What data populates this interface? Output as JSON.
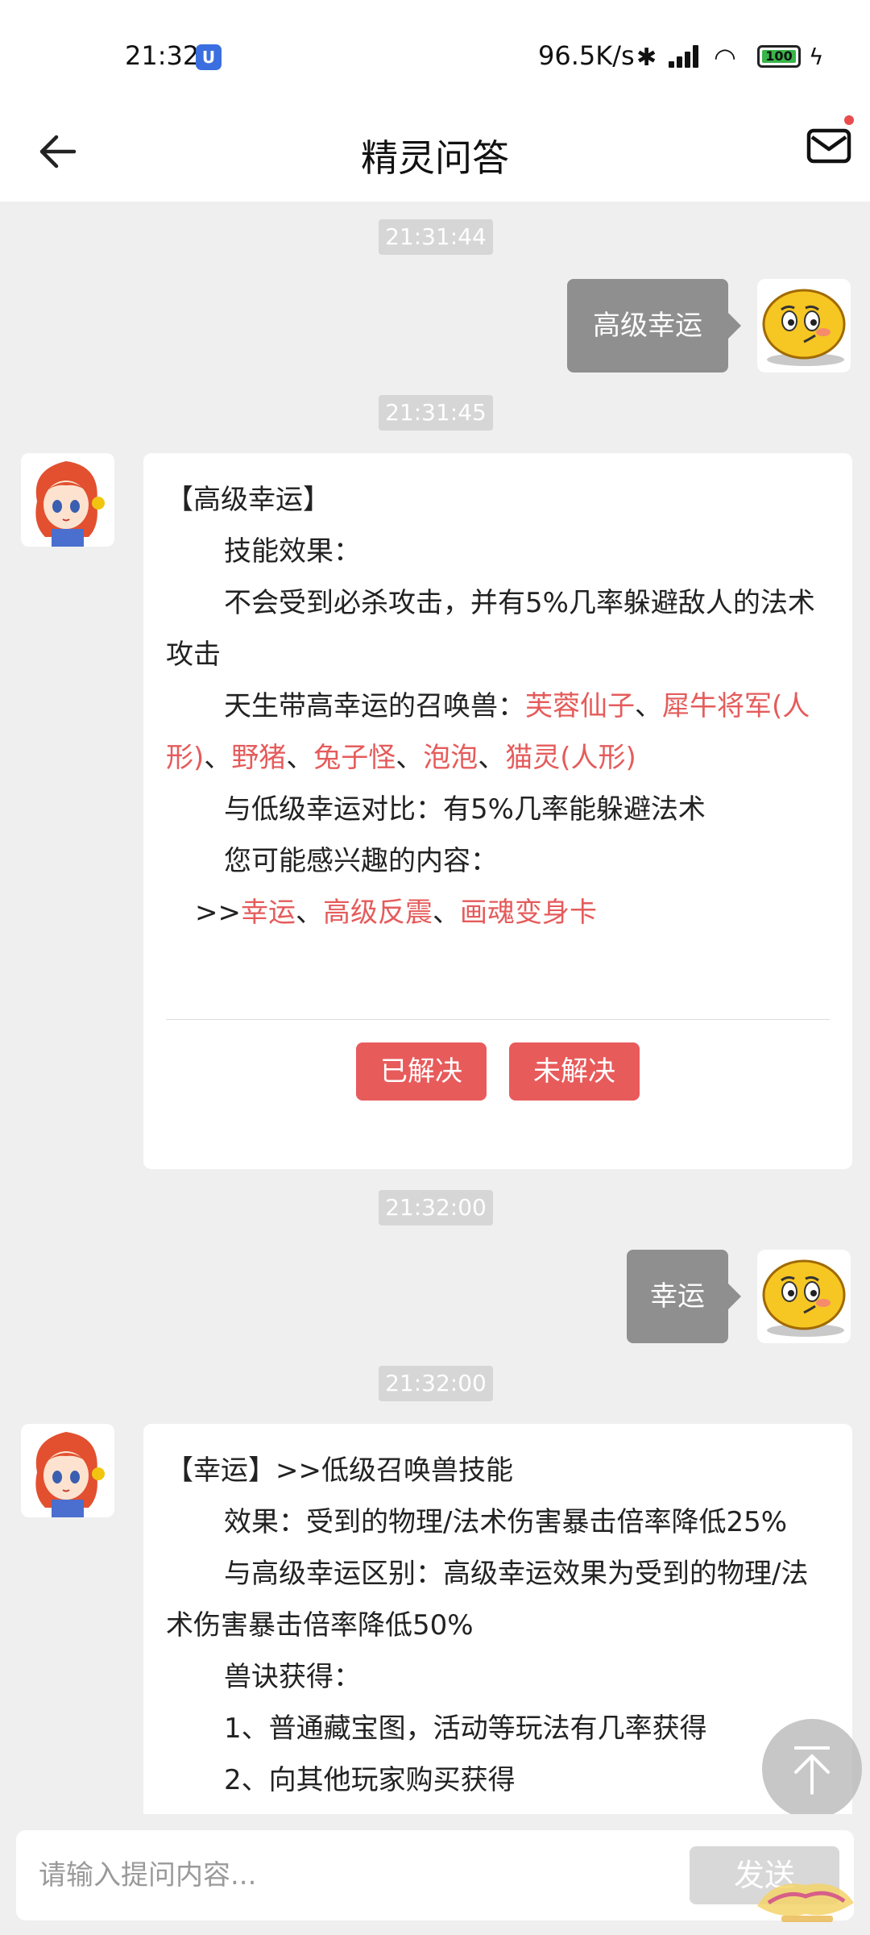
{
  "status_bar": {
    "time": "21:32",
    "net_speed": "96.5K/s",
    "battery": "100"
  },
  "header": {
    "title": "精灵问答"
  },
  "messages": {
    "ts1": "21:31:44",
    "q1": "高级幸运",
    "ts2": "21:31:45",
    "a1": {
      "title": "【高级幸运】",
      "effect_label": "技能效果：",
      "effect_text": "不会受到必杀攻击，并有5%几率躲避敌人的法术攻击",
      "pets_label": "天生带高幸运的召唤兽：",
      "pet1": "芙蓉仙子",
      "pet2": "犀牛将军(人形)",
      "pet3": "野猪",
      "pet4": "兔子怪",
      "pet5": "泡泡",
      "pet6": "猫灵(人形)",
      "sep": "、",
      "compare": "与低级幸运对比：有5%几率能躲避法术",
      "related_label": "您可能感兴趣的内容：",
      "related_prefix": ">>",
      "related1": "幸运",
      "related2": "高级反震",
      "related3": "画魂变身卡",
      "solved": "已解决",
      "unsolved": "未解决"
    },
    "ts3": "21:32:00",
    "q2": "幸运",
    "ts4": "21:32:00",
    "a2": {
      "title": "【幸运】>>低级召唤兽技能",
      "effect": "效果：受到的物理/法术伤害暴击倍率降低25%",
      "diff": "与高级幸运区别：高级幸运效果为受到的物理/法术伤害暴击倍率降低50%",
      "obtain_label": "兽诀获得：",
      "obtain1": "1、普通藏宝图，活动等玩法有几率获得",
      "obtain2": "2、向其他玩家购买获得"
    }
  },
  "input": {
    "placeholder": "请输入提问内容...",
    "send": "发送"
  }
}
